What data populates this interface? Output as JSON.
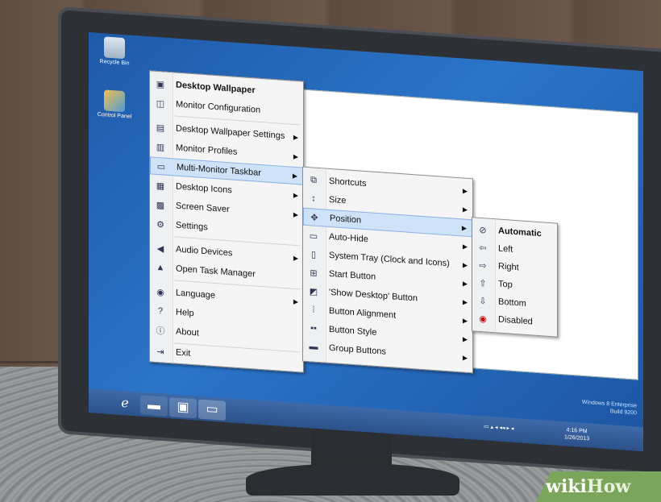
{
  "desktop": {
    "icons": [
      {
        "label": "Recycle Bin",
        "icon": "recycle-bin-icon"
      },
      {
        "label": "Control Panel",
        "icon": "control-panel-icon"
      }
    ],
    "watermark": [
      "Windows 8 Enterprise",
      "Build 9200"
    ],
    "clock": [
      "4:16 PM",
      "1/26/2013"
    ]
  },
  "main_menu": {
    "items": [
      {
        "label": "Desktop Wallpaper",
        "icon": "wallpaper-icon",
        "bold": true,
        "arrow": false
      },
      {
        "label": "Monitor Configuration",
        "icon": "monitor-config-icon",
        "arrow": false
      },
      {
        "label": "Desktop Wallpaper Settings",
        "icon": "wallpaper-settings-icon",
        "arrow": true
      },
      {
        "label": "Monitor Profiles",
        "icon": "monitor-profiles-icon",
        "arrow": true
      },
      {
        "label": "Multi-Monitor Taskbar",
        "icon": "taskbar-icon",
        "arrow": true,
        "highlighted": true
      },
      {
        "label": "Desktop Icons",
        "icon": "desktop-icons-icon",
        "arrow": true
      },
      {
        "label": "Screen Saver",
        "icon": "screen-saver-icon",
        "arrow": true
      },
      {
        "label": "Settings",
        "icon": "gear-icon",
        "arrow": false
      },
      {
        "label": "Audio Devices",
        "icon": "speaker-icon",
        "arrow": true
      },
      {
        "label": "Open Task Manager",
        "icon": "task-manager-icon",
        "arrow": false
      },
      {
        "label": "Language",
        "icon": "language-icon",
        "arrow": true
      },
      {
        "label": "Help",
        "icon": "help-icon",
        "arrow": false
      },
      {
        "label": "About",
        "icon": "info-icon",
        "arrow": false
      },
      {
        "label": "Exit",
        "icon": "exit-icon",
        "arrow": false
      }
    ]
  },
  "taskbar_menu": {
    "items": [
      {
        "label": "Shortcuts",
        "icon": "shortcuts-icon"
      },
      {
        "label": "Size",
        "icon": "size-icon"
      },
      {
        "label": "Position",
        "icon": "move-icon",
        "highlighted": true
      },
      {
        "label": "Auto-Hide",
        "icon": "auto-hide-icon"
      },
      {
        "label": "System Tray (Clock and Icons)",
        "icon": "system-tray-icon"
      },
      {
        "label": "Start Button",
        "icon": "start-button-icon"
      },
      {
        "label": "'Show Desktop' Button",
        "icon": "show-desktop-icon"
      },
      {
        "label": "Button Alignment",
        "icon": "alignment-icon"
      },
      {
        "label": "Button Style",
        "icon": "button-style-icon"
      },
      {
        "label": "Group Buttons",
        "icon": "group-buttons-icon"
      }
    ]
  },
  "position_menu": {
    "items": [
      {
        "label": "Automatic",
        "icon": "automatic-icon",
        "bold": true
      },
      {
        "label": "Left",
        "icon": "arrow-left-icon"
      },
      {
        "label": "Right",
        "icon": "arrow-right-icon"
      },
      {
        "label": "Top",
        "icon": "arrow-up-icon"
      },
      {
        "label": "Bottom",
        "icon": "arrow-down-icon"
      },
      {
        "label": "Disabled",
        "icon": "disabled-icon"
      }
    ]
  },
  "taskbar": {
    "buttons": [
      "internet-explorer-icon",
      "file-explorer-icon",
      "powerpoint-icon",
      "display-fusion-icon"
    ]
  },
  "brand": {
    "wiki": "wiki",
    "how": "How"
  }
}
